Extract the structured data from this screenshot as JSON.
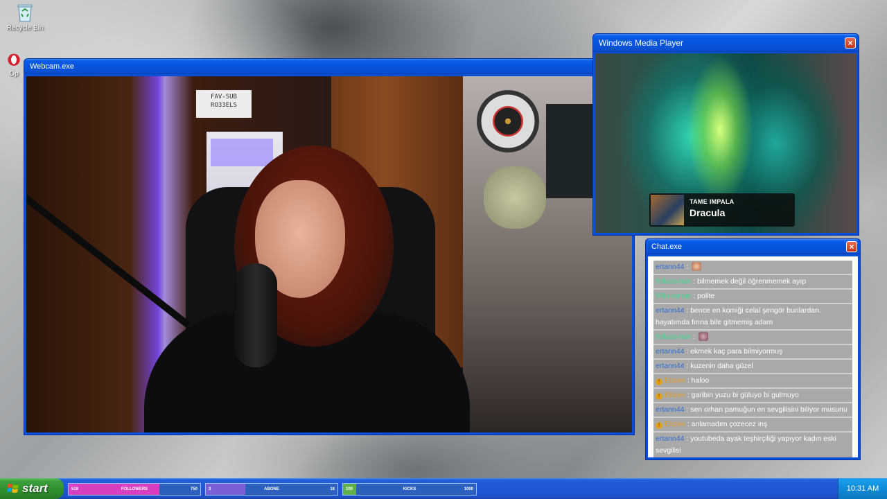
{
  "desktop": {
    "icons": [
      {
        "label": "Recycle Bin"
      },
      {
        "label": "Op"
      }
    ]
  },
  "webcam_window": {
    "title": "Webcam.exe",
    "sign_text": "FAV-SUB\nRO33ELS"
  },
  "media_window": {
    "title": "Windows Media Player",
    "now_playing": {
      "artist": "TAME IMPALA",
      "track": "Dracula"
    }
  },
  "chat_window": {
    "title": "Chat.exe",
    "messages": [
      {
        "user": "ertann44",
        "color": "blue",
        "badge": false,
        "text": "",
        "emote": "face"
      },
      {
        "user": "99luosman",
        "color": "green",
        "badge": false,
        "text": "bilmemek değil öğrenmemek ayıp"
      },
      {
        "user": "99luosman",
        "color": "green",
        "badge": false,
        "text": "polite"
      },
      {
        "user": "ertann44",
        "color": "blue",
        "badge": false,
        "text": "bence en komiği celal şengör bunlardan. hayatımda fırına bile gitmemiş adam"
      },
      {
        "user": "99luosman",
        "color": "green",
        "badge": false,
        "text": "",
        "emote": "cat"
      },
      {
        "user": "ertann44",
        "color": "blue",
        "badge": false,
        "text": "ekmek kaç para bilmiyormuş"
      },
      {
        "user": "ertann44",
        "color": "blue",
        "badge": false,
        "text": "kuzenin daha güzel"
      },
      {
        "user": "Ebzen",
        "color": "orange",
        "badge": true,
        "text": "haloo"
      },
      {
        "user": "Ebzen",
        "color": "orange",
        "badge": true,
        "text": "garibin yuzu bi güluyo bi gulmuyo"
      },
      {
        "user": "ertann44",
        "color": "blue",
        "badge": false,
        "text": "sen orhan pamuğun en sevgilisini biliyor musunu"
      },
      {
        "user": "Ebzen",
        "color": "orange",
        "badge": true,
        "text": "anlamadım çozecez inş"
      },
      {
        "user": "ertann44",
        "color": "blue",
        "badge": false,
        "text": "youtubeda ayak teşhirçiliği yapıyor kadın eski sevgilisi"
      }
    ]
  },
  "taskbar": {
    "start_label": "start",
    "goals": [
      {
        "start": "518",
        "label": "FOLLOWERS",
        "end": "750",
        "progress": 0.69,
        "fill": "#d63fc0"
      },
      {
        "start": "3",
        "label": "ABONE",
        "end": "18",
        "progress": 0.3,
        "fill": "#7b5fd6"
      },
      {
        "start": "100",
        "label": "KICKS",
        "end": "1000",
        "progress": 0.1,
        "fill": "#5fb04a"
      }
    ],
    "clock": "10:31 AM"
  },
  "colors": {
    "xp_blue": "#0a4fd8",
    "start_green": "#3b9d3b",
    "chat_row": "#a9a9a9",
    "user_blue": "#2f6fd1",
    "user_green": "#3fd98a",
    "user_orange": "#e79a1e"
  }
}
